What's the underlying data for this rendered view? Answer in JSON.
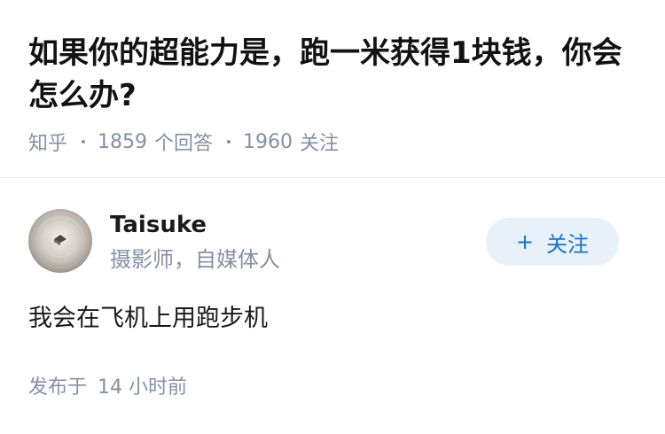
{
  "question": {
    "title": "如果你的超能力是，跑一米获得1块钱，你会怎么办?",
    "source": "知乎",
    "answer_count": "1859",
    "answer_label": "个回答",
    "follower_count": "1960",
    "follower_label": "关注"
  },
  "answer": {
    "author": {
      "name": "Taisuke",
      "bio": "摄影师，自媒体人",
      "avatar_icon": "avatar-image"
    },
    "follow_button": {
      "icon": "plus-icon",
      "label": "关注"
    },
    "content": "我会在飞机上用跑步机",
    "publish_label": "发布于",
    "publish_time": "14 小时前"
  },
  "colors": {
    "title": "#121212",
    "meta": "#8590a6",
    "accent": "#1772c6",
    "follow_bg": "#e8f0fa",
    "divider": "#ebebeb"
  }
}
